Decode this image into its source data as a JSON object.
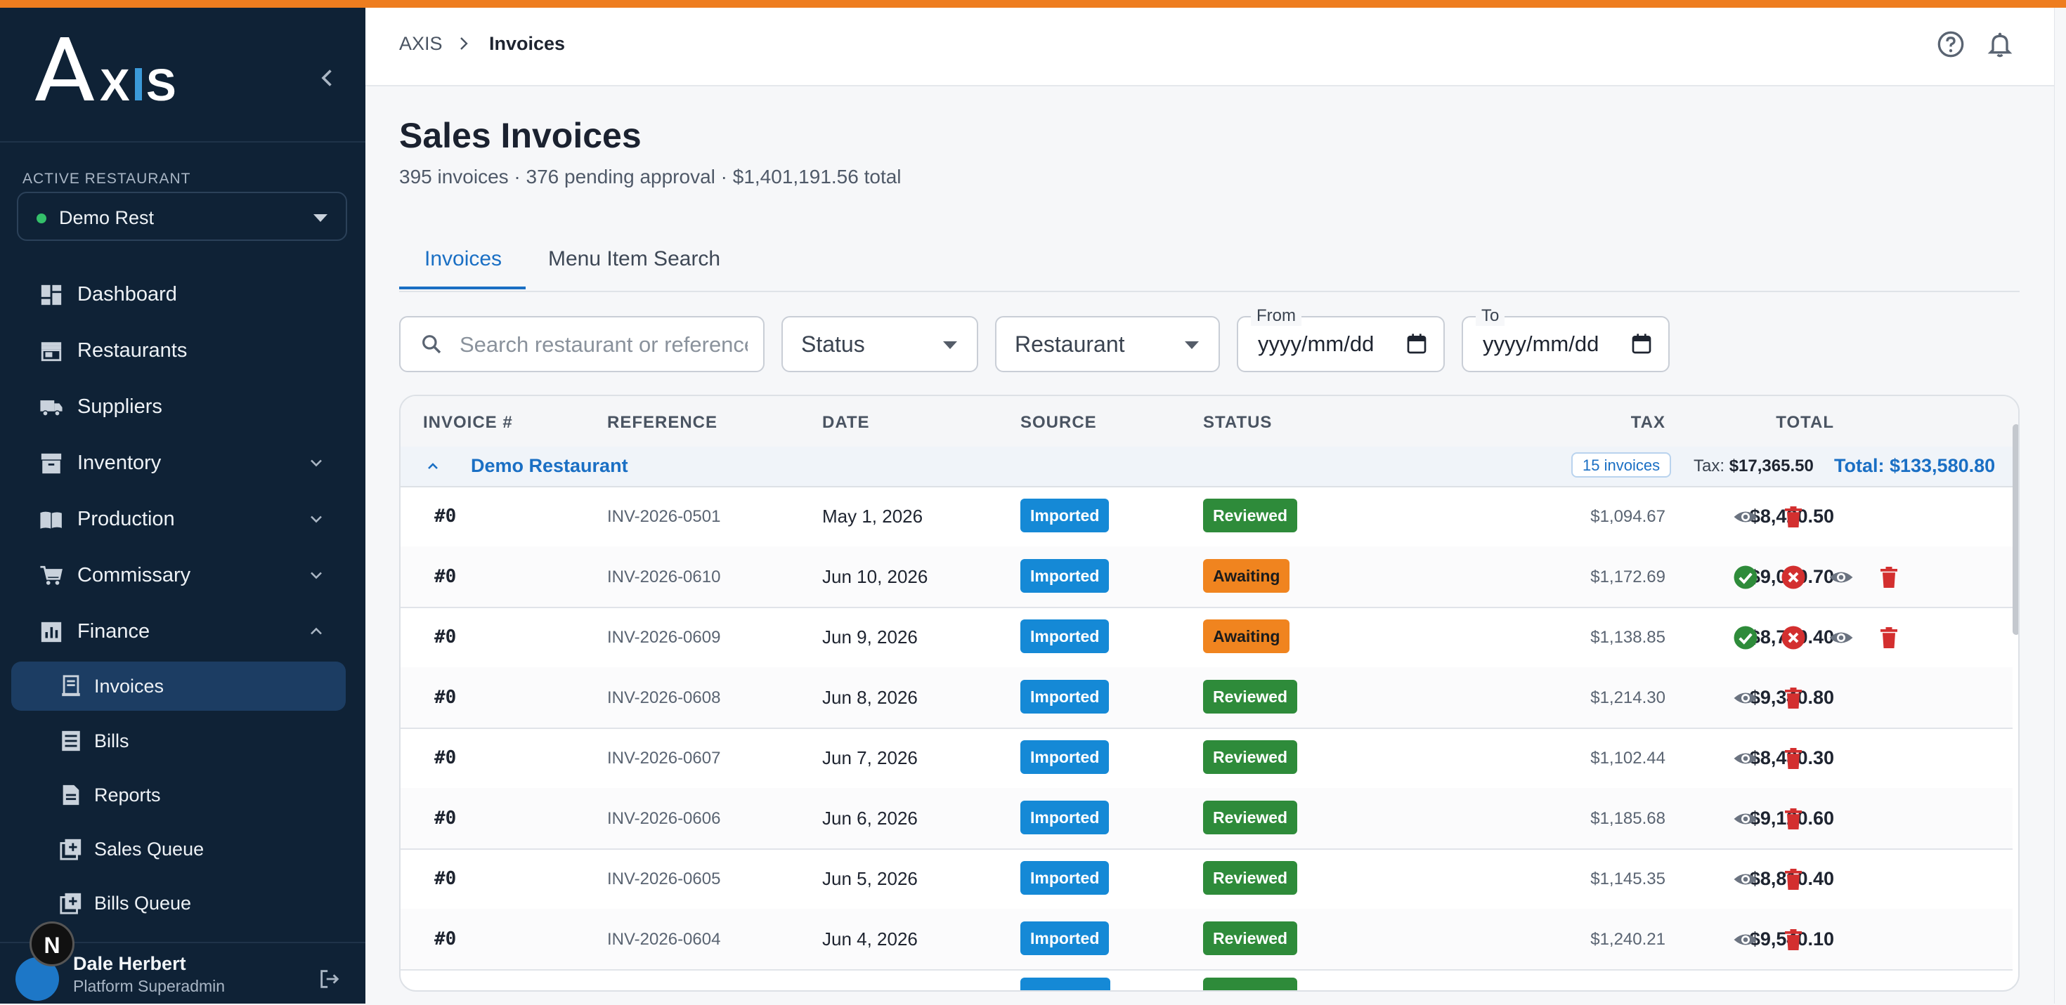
{
  "app": {
    "brand": "AXIS"
  },
  "sidebar": {
    "active_label": "ACTIVE RESTAURANT",
    "restaurant": "Demo Rest",
    "items": [
      {
        "label": "Dashboard",
        "icon": "dashboard-icon"
      },
      {
        "label": "Restaurants",
        "icon": "store-icon"
      },
      {
        "label": "Suppliers",
        "icon": "truck-icon"
      },
      {
        "label": "Inventory",
        "icon": "inventory-icon"
      },
      {
        "label": "Production",
        "icon": "book-icon"
      },
      {
        "label": "Commissary",
        "icon": "cart-icon"
      },
      {
        "label": "Finance",
        "icon": "chart-icon"
      }
    ],
    "finance_sub": [
      {
        "label": "Invoices",
        "icon": "invoice-icon"
      },
      {
        "label": "Bills",
        "icon": "bills-icon"
      },
      {
        "label": "Reports",
        "icon": "reports-icon"
      },
      {
        "label": "Sales Queue",
        "icon": "queue-icon"
      },
      {
        "label": "Bills Queue",
        "icon": "queue-icon"
      }
    ],
    "user": {
      "name": "Dale Herbert",
      "role": "Platform Superadmin",
      "overlay_letter": "N"
    }
  },
  "header": {
    "breadcrumb_root": "AXIS",
    "breadcrumb_current": "Invoices"
  },
  "page": {
    "title": "Sales Invoices",
    "subtitle": "395 invoices · 376 pending approval · $1,401,191.56 total"
  },
  "tabs": [
    "Invoices",
    "Menu Item Search"
  ],
  "filters": {
    "search_placeholder": "Search restaurant or reference",
    "status": "Status",
    "restaurant": "Restaurant",
    "from_label": "From",
    "from_value": "yyyy/mm/dd",
    "to_label": "To",
    "to_value": "yyyy/mm/dd"
  },
  "table": {
    "columns": [
      "INVOICE #",
      "REFERENCE",
      "DATE",
      "SOURCE",
      "STATUS",
      "TAX",
      "TOTAL"
    ],
    "group": {
      "name": "Demo Restaurant",
      "count": "15 invoices",
      "tax_label": "Tax:",
      "tax": "$17,365.50",
      "total": "Total: $133,580.80"
    },
    "rows": [
      {
        "num": "#0",
        "ref": "INV-2026-0501",
        "date": "May 1, 2026",
        "source": "Imported",
        "status": "Reviewed",
        "tax": "$1,094.67",
        "total": "$8,420.50"
      },
      {
        "num": "#0",
        "ref": "INV-2026-0610",
        "date": "Jun 10, 2026",
        "source": "Imported",
        "status": "Awaiting",
        "tax": "$1,172.69",
        "total": "$9,020.70"
      },
      {
        "num": "#0",
        "ref": "INV-2026-0609",
        "date": "Jun 9, 2026",
        "source": "Imported",
        "status": "Awaiting",
        "tax": "$1,138.85",
        "total": "$8,760.40"
      },
      {
        "num": "#0",
        "ref": "INV-2026-0608",
        "date": "Jun 8, 2026",
        "source": "Imported",
        "status": "Reviewed",
        "tax": "$1,214.30",
        "total": "$9,340.80"
      },
      {
        "num": "#0",
        "ref": "INV-2026-0607",
        "date": "Jun 7, 2026",
        "source": "Imported",
        "status": "Reviewed",
        "tax": "$1,102.44",
        "total": "$8,480.30"
      },
      {
        "num": "#0",
        "ref": "INV-2026-0606",
        "date": "Jun 6, 2026",
        "source": "Imported",
        "status": "Reviewed",
        "tax": "$1,185.68",
        "total": "$9,120.60"
      },
      {
        "num": "#0",
        "ref": "INV-2026-0605",
        "date": "Jun 5, 2026",
        "source": "Imported",
        "status": "Reviewed",
        "tax": "$1,145.35",
        "total": "$8,810.40"
      },
      {
        "num": "#0",
        "ref": "INV-2026-0604",
        "date": "Jun 4, 2026",
        "source": "Imported",
        "status": "Reviewed",
        "tax": "$1,240.21",
        "total": "$9,540.10"
      }
    ]
  },
  "colors": {
    "accent_bar": "#ee7d1f",
    "sidebar_bg": "#0f2236",
    "primary": "#1a6fc4",
    "reviewed": "#2e8b3a",
    "awaiting": "#f0841f",
    "imported": "#1589d6",
    "delete": "#d32f2f"
  }
}
